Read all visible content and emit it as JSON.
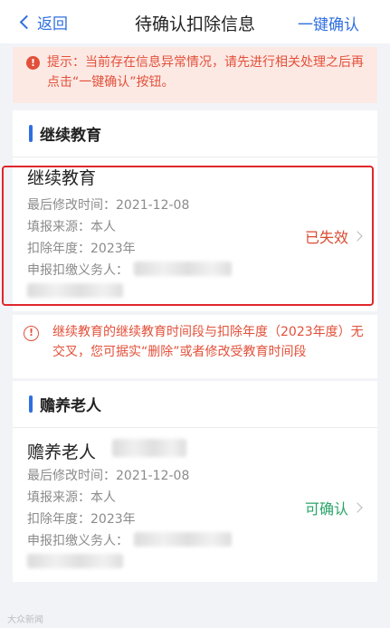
{
  "header": {
    "back_label": "返回",
    "title": "待确认扣除信息",
    "confirm_all_label": "一键确认"
  },
  "notice": {
    "text": "提示：当前存在信息异常情况，请先进行相关处理之后再点击“一键确认”按钮。"
  },
  "sections": [
    {
      "heading": "继续教育",
      "card": {
        "title": "继续教育",
        "rows": [
          {
            "label": "最后修改时间：",
            "value": "2021-12-08"
          },
          {
            "label": "填报来源：",
            "value": "本人"
          },
          {
            "label": "扣除年度：",
            "value": "2023年"
          },
          {
            "label": "申报扣缴义务人：",
            "value": ""
          }
        ],
        "status": "已失效"
      },
      "warning": "继续教育的继续教育时间段与扣除年度（2023年度）无交叉，您可据实“删除”或者修改受教育时间段"
    },
    {
      "heading": "赡养老人",
      "card": {
        "title": "赡养老人",
        "rows": [
          {
            "label": "最后修改时间：",
            "value": "2021-12-08"
          },
          {
            "label": "填报来源：",
            "value": "本人"
          },
          {
            "label": "扣除年度：",
            "value": "2023年"
          },
          {
            "label": "申报扣缴义务人：",
            "value": ""
          }
        ],
        "status": "可确认"
      }
    }
  ],
  "colors": {
    "accent": "#2f6fe0",
    "alert": "#e2503a",
    "expired": "#d94a30",
    "confirmable": "#28a468",
    "highlight_frame": "#e0272b"
  },
  "watermark": "大众新闻"
}
